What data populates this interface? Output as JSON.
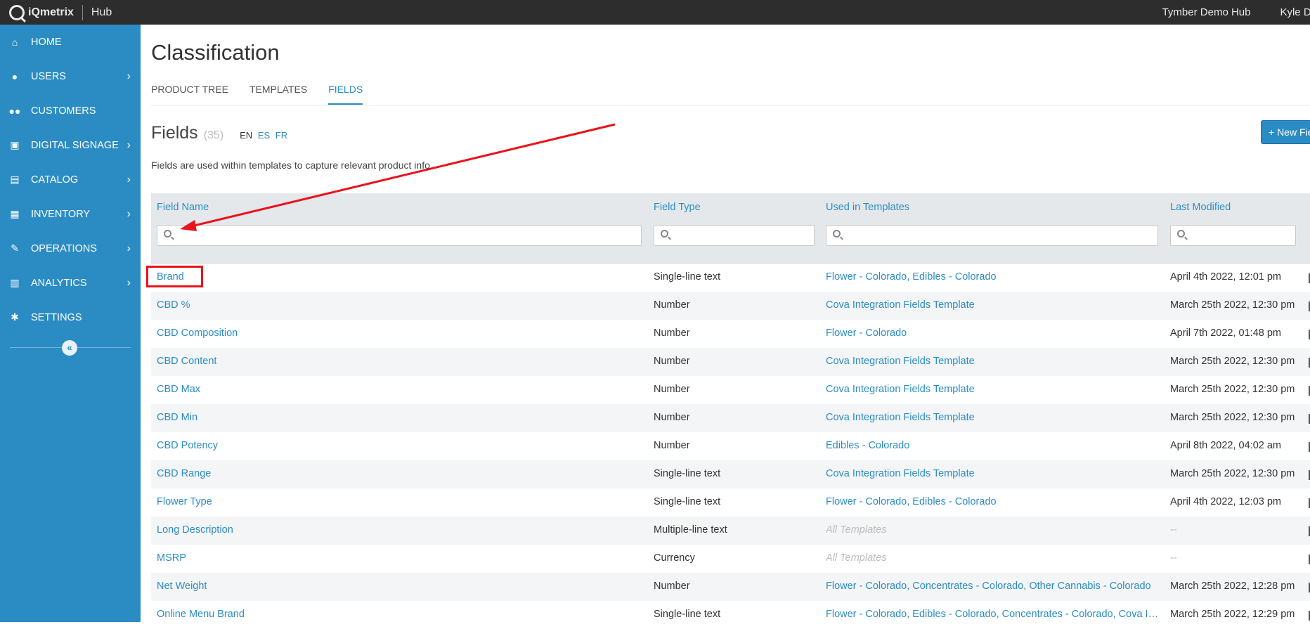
{
  "topbar": {
    "brand": "iQmetrix",
    "hub": "Hub",
    "org": "Tymber Demo Hub",
    "user": "Kyle Du"
  },
  "sidebar": {
    "items": [
      {
        "label": "HOME",
        "icon": "home-icon",
        "glyph": "⌂",
        "chevron": false
      },
      {
        "label": "USERS",
        "icon": "user-icon",
        "glyph": "●",
        "chevron": true
      },
      {
        "label": "CUSTOMERS",
        "icon": "customers-icon",
        "glyph": "●●",
        "chevron": false
      },
      {
        "label": "DIGITAL SIGNAGE",
        "icon": "signage-icon",
        "glyph": "▣",
        "chevron": true
      },
      {
        "label": "CATALOG",
        "icon": "book-icon",
        "glyph": "▤",
        "chevron": true
      },
      {
        "label": "INVENTORY",
        "icon": "boxes-icon",
        "glyph": "▦",
        "chevron": true
      },
      {
        "label": "OPERATIONS",
        "icon": "wrench-icon",
        "glyph": "✎",
        "chevron": true
      },
      {
        "label": "ANALYTICS",
        "icon": "bar-chart-icon",
        "glyph": "▥",
        "chevron": true
      },
      {
        "label": "SETTINGS",
        "icon": "gear-icon",
        "glyph": "✱",
        "chevron": false
      }
    ],
    "collapse_glyph": "«",
    "chevron_glyph": "›"
  },
  "main": {
    "title": "Classification",
    "tabs": [
      {
        "label": "PRODUCT TREE",
        "active": false
      },
      {
        "label": "TEMPLATES",
        "active": false
      },
      {
        "label": "FIELDS",
        "active": true
      }
    ],
    "section_title": "Fields",
    "count": "(35)",
    "langs": {
      "current": "EN",
      "others": [
        "ES",
        "FR"
      ]
    },
    "new_button": "+ New Field",
    "description": "Fields are used within templates to capture relevant product info."
  },
  "table": {
    "columns": [
      "Field Name",
      "Field Type",
      "Used in Templates",
      "Last Modified"
    ],
    "rows": [
      {
        "name": "Brand",
        "type": "Single-line text",
        "templates": "Flower - Colorado, Edibles - Colorado",
        "modified": "April 4th 2022, 12:01 pm"
      },
      {
        "name": "CBD %",
        "type": "Number",
        "templates": "Cova Integration Fields Template",
        "modified": "March 25th 2022, 12:30 pm"
      },
      {
        "name": "CBD Composition",
        "type": "Number",
        "templates": "Flower - Colorado",
        "modified": "April 7th 2022, 01:48 pm"
      },
      {
        "name": "CBD Content",
        "type": "Number",
        "templates": "Cova Integration Fields Template",
        "modified": "March 25th 2022, 12:30 pm"
      },
      {
        "name": "CBD Max",
        "type": "Number",
        "templates": "Cova Integration Fields Template",
        "modified": "March 25th 2022, 12:30 pm"
      },
      {
        "name": "CBD Min",
        "type": "Number",
        "templates": "Cova Integration Fields Template",
        "modified": "March 25th 2022, 12:30 pm"
      },
      {
        "name": "CBD Potency",
        "type": "Number",
        "templates": "Edibles - Colorado",
        "modified": "April 8th 2022, 04:02 am"
      },
      {
        "name": "CBD Range",
        "type": "Single-line text",
        "templates": "Cova Integration Fields Template",
        "modified": "March 25th 2022, 12:30 pm"
      },
      {
        "name": "Flower Type",
        "type": "Single-line text",
        "templates": "Flower - Colorado, Edibles - Colorado",
        "modified": "April 4th 2022, 12:03 pm"
      },
      {
        "name": "Long Description",
        "type": "Multiple-line text",
        "templates": "All Templates",
        "templates_muted": true,
        "modified": "--",
        "modified_muted": true
      },
      {
        "name": "MSRP",
        "type": "Currency",
        "templates": "All Templates",
        "templates_muted": true,
        "modified": "--",
        "modified_muted": true
      },
      {
        "name": "Net Weight",
        "type": "Number",
        "templates": "Flower - Colorado, Concentrates - Colorado, Other Cannabis - Colorado",
        "modified": "March 25th 2022, 12:28 pm"
      },
      {
        "name": "Online Menu Brand",
        "type": "Single-line text",
        "templates": "Flower - Colorado, Edibles - Colorado, Concentrates - Colorado, Cova Integration Fields Template",
        "modified": "March 25th 2022, 12:29 pm"
      }
    ]
  },
  "colors": {
    "accent": "#2b8cc4",
    "topbar": "#2d2d2d",
    "annotation": "#e8141c"
  }
}
